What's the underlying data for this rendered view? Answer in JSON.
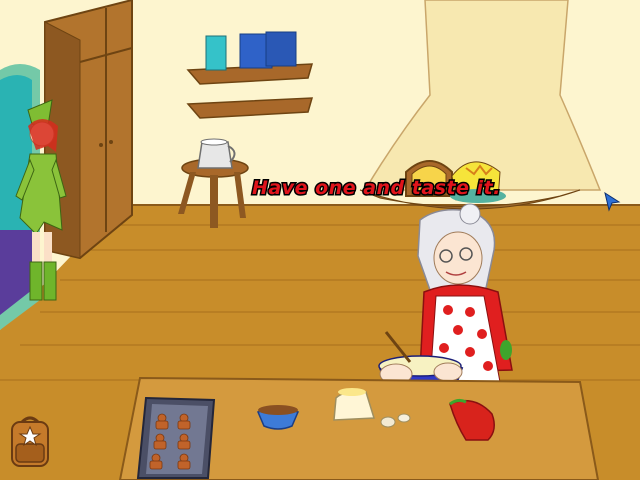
{
  "scene": {
    "dialogue": "Have one and taste it.",
    "colors": {
      "wall": "#fdf5cf",
      "floor": "#c88d2a",
      "wood": "#b2742d",
      "table": "#d49a3e",
      "dialogue_text": "#e0141b",
      "dialogue_outline": "#000000",
      "cursor": "#2c6fd6"
    }
  },
  "characters": [
    {
      "name": "elf-girl",
      "outfit_color": "#8ac33a"
    },
    {
      "name": "grandmother-baker",
      "dress_color": "#e01f1f",
      "apron_pattern": "polka-dot"
    }
  ],
  "inventory": {
    "icon": "backpack-icon",
    "badge_icon": "star-icon"
  }
}
